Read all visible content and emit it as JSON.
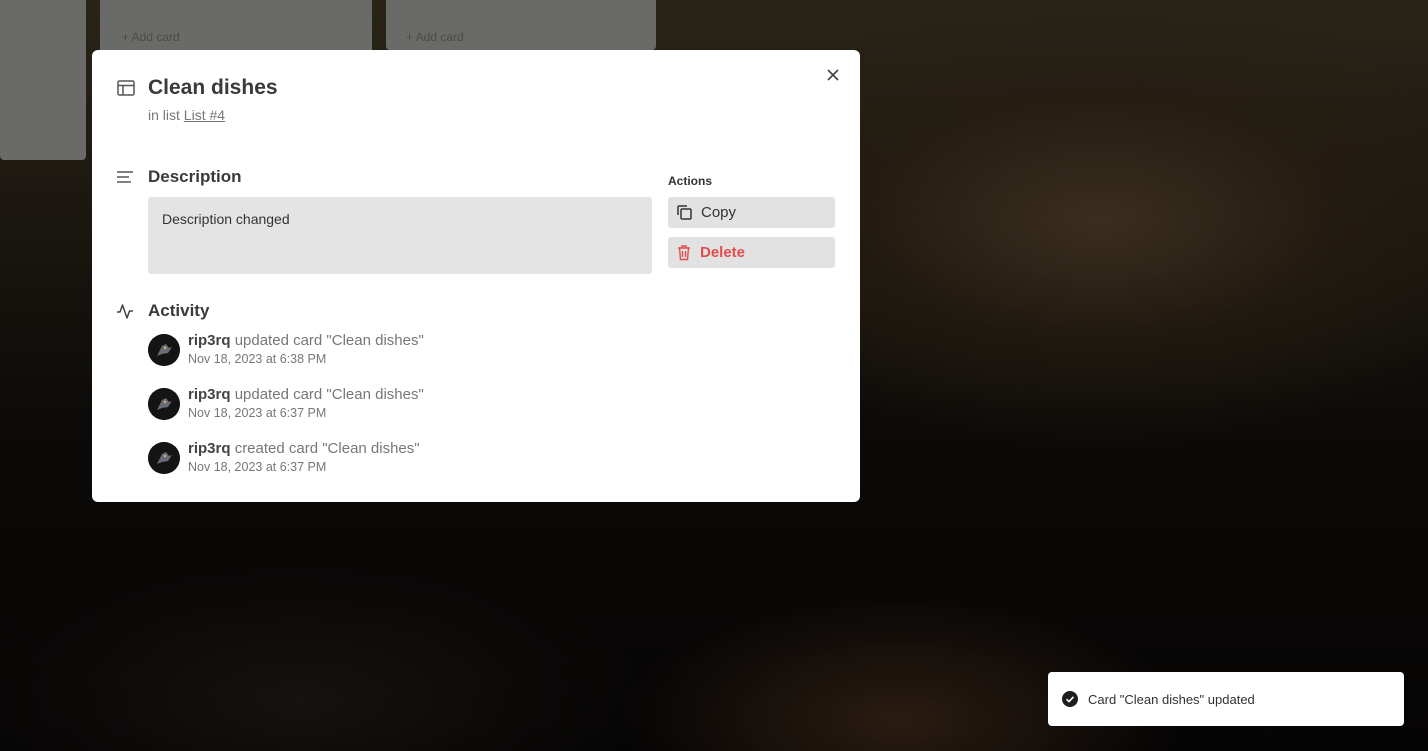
{
  "board": {
    "add_card_1": "+ Add card",
    "add_card_2": "+ Add card"
  },
  "card": {
    "title": "Clean dishes",
    "in_list_prefix": "in list",
    "list_name": "List #4",
    "icon": "card-icon"
  },
  "description": {
    "label": "Description",
    "text": "Description changed"
  },
  "actions": {
    "label": "Actions",
    "copy_label": "Copy",
    "delete_label": "Delete"
  },
  "activity": {
    "label": "Activity",
    "items": [
      {
        "user": "rip3rq",
        "text": "updated card \"Clean dishes\"",
        "date": "Nov 18, 2023 at 6:38 PM"
      },
      {
        "user": "rip3rq",
        "text": "updated card \"Clean dishes\"",
        "date": "Nov 18, 2023 at 6:37 PM"
      },
      {
        "user": "rip3rq",
        "text": "created card \"Clean dishes\"",
        "date": "Nov 18, 2023 at 6:37 PM"
      }
    ]
  },
  "toast": {
    "message": "Card \"Clean dishes\" updated"
  },
  "colors": {
    "delete": "#e14c4c",
    "overlay": "#0c0a08"
  }
}
